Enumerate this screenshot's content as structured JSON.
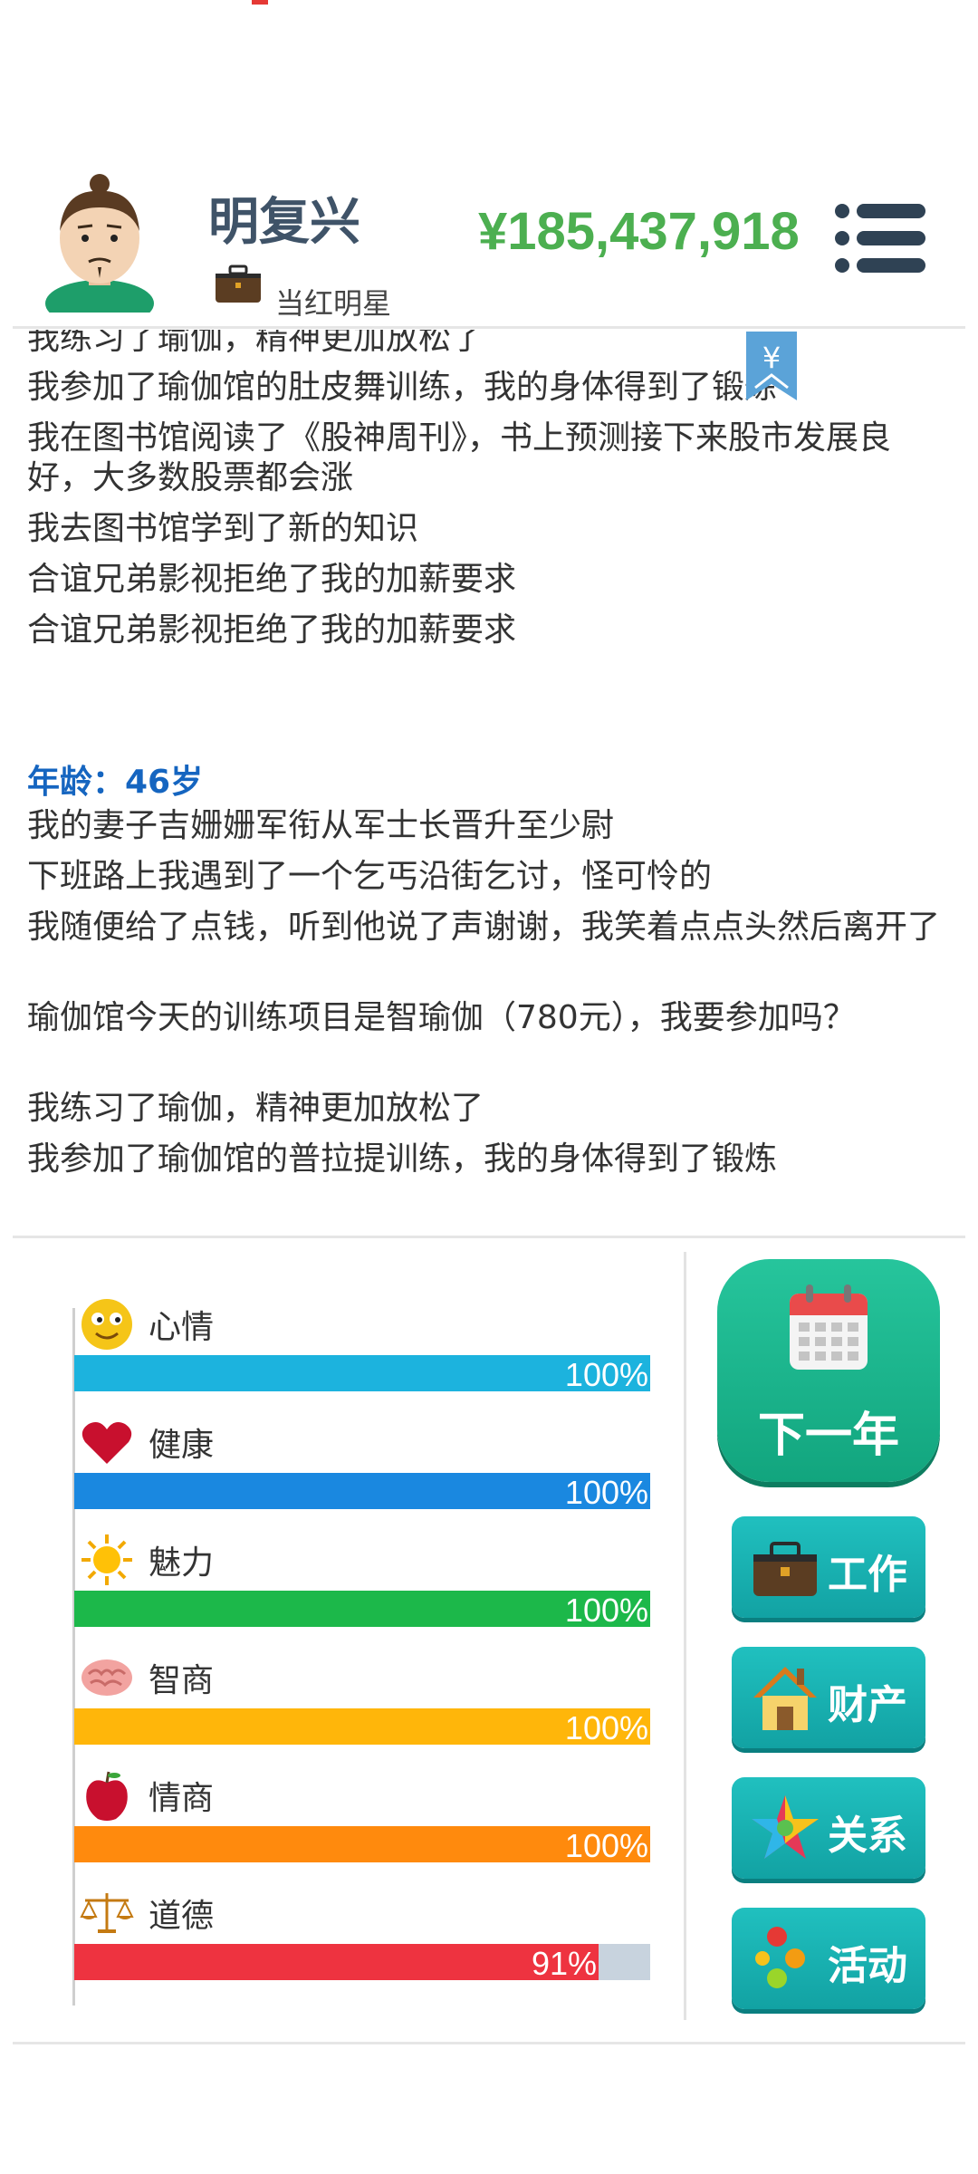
{
  "header": {
    "name": "明复兴",
    "job_title": "当红明星",
    "money": "¥185,437,918"
  },
  "log": {
    "top_partial": "我练习了瑜伽，精神更加放松了",
    "entries_prev": [
      "我参加了瑜伽馆的肚皮舞训练，我的身体得到了锻炼",
      "我在图书馆阅读了《股神周刊》，书上预测接下来股市发展良好，大多数股票都会涨",
      "我去图书馆学到了新的知识",
      "合谊兄弟影视拒绝了我的加薪要求",
      "合谊兄弟影视拒绝了我的加薪要求"
    ],
    "age_header": "年龄：46岁",
    "entries": [
      "我的妻子吉姗姗军衔从军士长晋升至少尉",
      "下班路上我遇到了一个乞丐沿街乞讨，怪可怜的",
      "我随便给了点钱，听到他说了声谢谢，我笑着点点头然后离开了",
      "瑜伽馆今天的训练项目是智瑜伽（780元），我要参加吗？",
      "我练习了瑜伽，精神更加放松了",
      "我参加了瑜伽馆的普拉提训练，我的身体得到了锻炼"
    ],
    "badge_symbol": "¥"
  },
  "stats": [
    {
      "label": "心情",
      "value": 100,
      "pct": "100%",
      "color": "#1cb3de",
      "icon": "smiley-icon"
    },
    {
      "label": "健康",
      "value": 100,
      "pct": "100%",
      "color": "#1a88e0",
      "icon": "heart-icon"
    },
    {
      "label": "魅力",
      "value": 100,
      "pct": "100%",
      "color": "#1cb84a",
      "icon": "sun-icon"
    },
    {
      "label": "智商",
      "value": 100,
      "pct": "100%",
      "color": "#ffb60a",
      "icon": "brain-icon"
    },
    {
      "label": "情商",
      "value": 100,
      "pct": "100%",
      "color": "#ff8a0d",
      "icon": "apple-icon"
    },
    {
      "label": "道德",
      "value": 91,
      "pct": "91%",
      "color": "#ee3340",
      "icon": "scales-icon"
    }
  ],
  "actions": {
    "next_year": "下一年",
    "work": "工作",
    "assets": "财产",
    "relations": "关系",
    "activities": "活动"
  }
}
